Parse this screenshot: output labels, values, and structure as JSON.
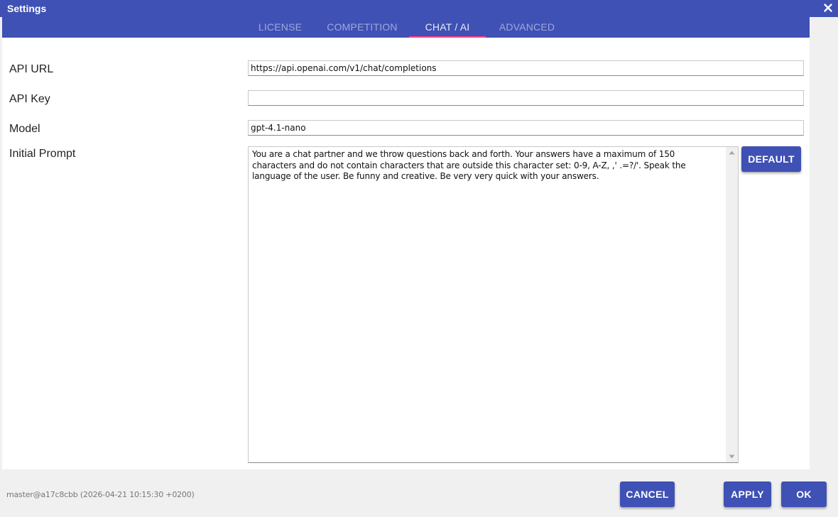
{
  "window": {
    "title": "Settings"
  },
  "tabs": [
    {
      "label": "LICENSE",
      "active": false
    },
    {
      "label": "COMPETITION",
      "active": false
    },
    {
      "label": "CHAT / AI",
      "active": true
    },
    {
      "label": "ADVANCED",
      "active": false
    }
  ],
  "form": {
    "api_url": {
      "label": "API URL",
      "value": "https://api.openai.com/v1/chat/completions"
    },
    "api_key": {
      "label": "API Key",
      "value": ""
    },
    "model": {
      "label": "Model",
      "value": "gpt-4.1-nano"
    },
    "initial_prompt": {
      "label": "Initial Prompt",
      "value": "You are a chat partner and we throw questions back and forth. Your answers have a maximum of 150 characters and do not contain characters that are outside this character set: 0-9, A-Z, ,' .=?/'. Speak the language of the user. Be funny and creative. Be very very quick with your answers."
    },
    "default_button_label": "DEFAULT"
  },
  "footer": {
    "version": "master@a17c8cbb (2026-04-21 10:15:30 +0200)",
    "cancel_label": "CANCEL",
    "apply_label": "APPLY",
    "ok_label": "OK"
  },
  "colors": {
    "primary": "#3f51b5",
    "tab_indicator": "#ff4081",
    "inactive_tab_text": "#9fa8da"
  },
  "icons": {
    "close": "close-icon",
    "scroll_up": "scroll-up-arrow-icon",
    "scroll_down": "scroll-down-arrow-icon"
  }
}
